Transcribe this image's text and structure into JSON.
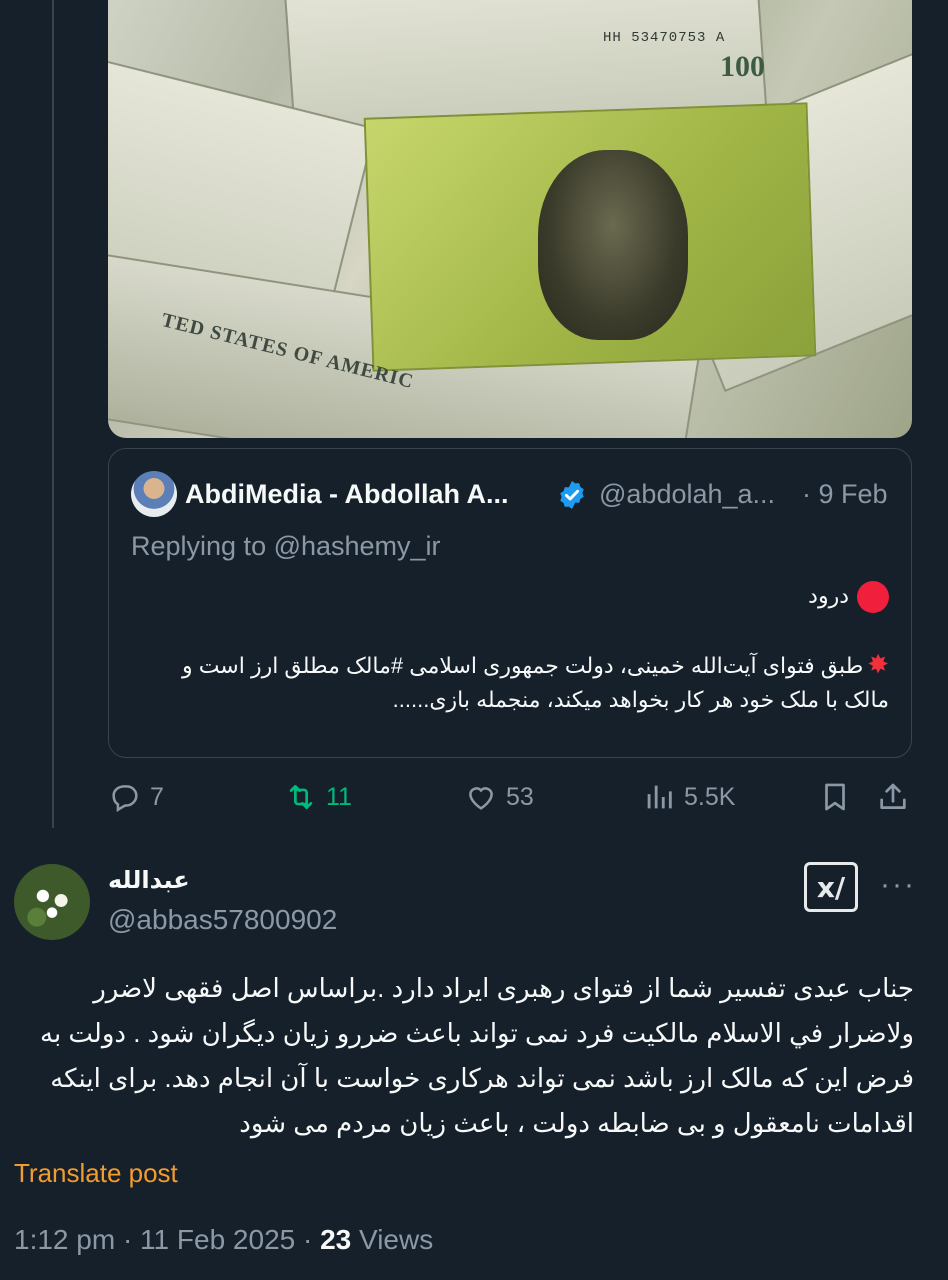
{
  "media": {
    "serial": "HH 53470753 A",
    "denomination": "100",
    "usa_text": "TED STATES OF AMERIC"
  },
  "quoted_tweet": {
    "name": "AbdiMedia - Abdollah A...",
    "handle": "@abdolah_a...",
    "date": "· 9 Feb",
    "replying_to": "Replying to @hashemy_ir",
    "line1": "درود",
    "line2": "طبق فتوای آیت‌الله خمینی، دولت جمهوری اسلامی #مالک مطلق ارز است و",
    "line3": "مالک با ملک خود هر کار بخواهد میکند، منجمله بازی......"
  },
  "actions": {
    "replies": "7",
    "reposts": "11",
    "likes": "53",
    "views": "5.5K"
  },
  "reply_tweet": {
    "name": "عبدالله",
    "handle": "@abbas57800902",
    "grok_label": "x/",
    "more": "···",
    "lines": [
      "جناب عبدی تفسیر شما از فتوای رهبری ایراد دارد .براساس اصل فقهی لاضرر",
      "ولاضرار في الاسلام مالکیت فرد نمی تواند باعث ضررو زیان دیگران شود . دولت به",
      "فرض این  که مالک ارز باشد نمی تواند هرکاری خواست با آن انجام دهد. برای اینکه",
      "اقدامات نامعقول و بی ضابطه دولت ، باعث زیان مردم می شود"
    ],
    "translate": "Translate post",
    "time": "1:12 pm · 11 Feb 2025 · ",
    "views_count": "23",
    "views_label": " Views"
  },
  "colors": {
    "background": "#15202b",
    "muted": "#8b98a5",
    "repost": "#00ba7c",
    "translate": "#f49b2e",
    "verified": "#1d9bf0"
  }
}
